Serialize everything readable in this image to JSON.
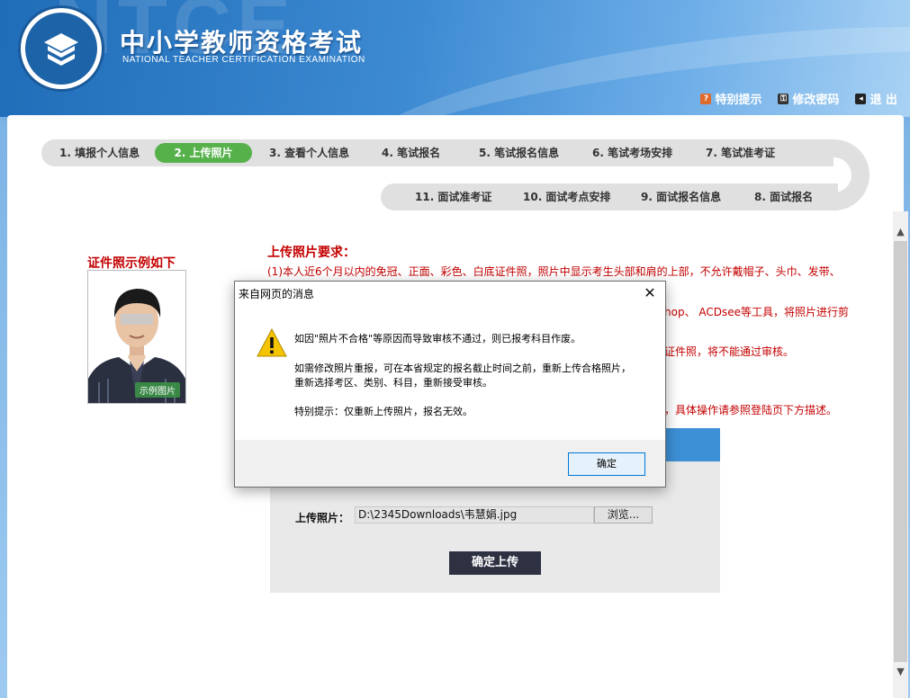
{
  "header": {
    "title": "中小学教师资格考试",
    "subtitle": "NATIONAL TEACHER CERTIFICATION EXAMINATION",
    "links": [
      {
        "label": "特别提示",
        "icon": "help-icon"
      },
      {
        "label": "修改密码",
        "icon": "key-icon"
      },
      {
        "label": "退 出",
        "icon": "exit-icon"
      }
    ]
  },
  "steps_row1": [
    {
      "label": "1. 填报个人信息"
    },
    {
      "label": "2. 上传照片",
      "active": true
    },
    {
      "label": "3. 查看个人信息"
    },
    {
      "label": "4. 笔试报名"
    },
    {
      "label": "5. 笔试报名信息"
    },
    {
      "label": "6. 笔试考场安排"
    },
    {
      "label": "7. 笔试准考证"
    }
  ],
  "steps_row2": [
    {
      "label": "11. 面试准考证"
    },
    {
      "label": "10. 面试考点安排"
    },
    {
      "label": "9. 面试报名信息"
    },
    {
      "label": "8. 面试报名"
    }
  ],
  "example": {
    "title": "证件照示例如下",
    "badge": "示例图片"
  },
  "requirements": {
    "title": "上传照片要求：",
    "lines": [
      "(1)本人近6个月以内的免冠、正面、彩色、白底证件照，照片中显示考生头部和肩的上部，不允许戴帽子、头巾、发带、",
      "hop、 ACDsee等工具，将照片进行剪",
      "证件照，将不能通过审核。",
      "，具体操作请参照登陆页下方描述。"
    ]
  },
  "upload": {
    "label": "上传照片：",
    "file_value": "D:\\2345Downloads\\韦慧娟.jpg",
    "browse_label": "浏览...",
    "submit_label": "确定上传"
  },
  "dialog": {
    "title": "来自网页的消息",
    "close": "✕",
    "lines": [
      "如因\"照片不合格\"等原因而导致审核不通过，则已报考科目作废。",
      "如需修改照片重报，可在本省规定的报名截止时间之前，重新上传合格照片，",
      "重新选择考区、类别、科目，重新接受审核。",
      "特别提示：仅重新上传照片，报名无效。"
    ],
    "ok_label": "确定"
  },
  "colors": {
    "accent_red": "#c40000",
    "active_step": "#56b14a",
    "header_blue": "#2f7cc6",
    "button_dark": "#2d3142"
  }
}
